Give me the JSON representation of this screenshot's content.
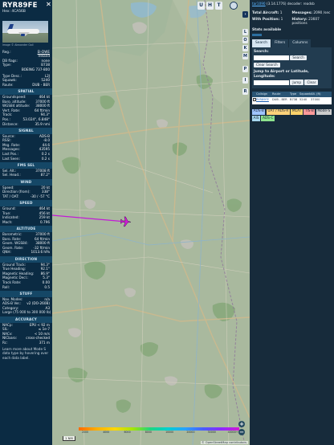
{
  "aircraft": {
    "callsign": "RYR89FE",
    "hex_line": "Hex: 4CA56B",
    "photo_credit": "Image © Alexander Gall",
    "reg_label": "Reg.:",
    "reg_value": "EI-DWE",
    "country": "Ireland",
    "db_flags_label": "DB flags:",
    "db_flags_value": "none",
    "type_label": "Type:",
    "type_value": "B738",
    "type_name": "BOEING 737-800",
    "type_desc_label": "Type Desc.:",
    "type_desc_value": "L2J",
    "squawk_label": "Squawk:",
    "squawk_value": "5240",
    "route_label": "Route:",
    "route_value": "DUB - BER"
  },
  "sections": {
    "spatial": "SPATIAL",
    "signal": "SIGNAL",
    "fms_sel": "FMS SEL",
    "wind": "WIND",
    "speed": "SPEED",
    "altitude": "ALTITUDE",
    "direction": "DIRECTION",
    "stuff": "STUFF",
    "accuracy": "ACCURACY"
  },
  "spatial": [
    {
      "k": "Groundspeed:",
      "v": "464 kt"
    },
    {
      "k": "Baro. altitude:",
      "v": "37000 ft"
    },
    {
      "k": "WGS84 altitude:",
      "v": "38000 ft"
    },
    {
      "k": "Vert. Rate:",
      "v": "64 ft/min"
    },
    {
      "k": "Track:",
      "v": "94.3°"
    },
    {
      "k": "Pos.:",
      "v": "53.024°, 6.848°"
    },
    {
      "k": "Distance:",
      "v": "35.9 nmi"
    }
  ],
  "signal": [
    {
      "k": "Source:",
      "v": "ADS-B"
    },
    {
      "k": "RSSI:",
      "v": "-8.0"
    },
    {
      "k": "Msg. Rate:",
      "v": "44.6"
    },
    {
      "k": "Messages:",
      "v": "43595"
    },
    {
      "k": "Last Pos.:",
      "v": "0.2 s"
    },
    {
      "k": "Last Seen:",
      "v": "0.2 s"
    }
  ],
  "fms": [
    {
      "k": "Sel. Alt.:",
      "v": "37008 ft"
    },
    {
      "k": "Sel. Head.:",
      "v": "87.2°"
    }
  ],
  "wind": [
    {
      "k": "Speed:",
      "v": "20 kt"
    },
    {
      "k": "Direction (from):",
      "v": "338°"
    },
    {
      "k": "TAT / OAT:",
      "v": "-30 / -57 °C"
    }
  ],
  "speed": [
    {
      "k": "Ground:",
      "v": "464 kt"
    },
    {
      "k": "True:",
      "v": "456 kt"
    },
    {
      "k": "Indicated:",
      "v": "259 kt"
    },
    {
      "k": "Mach:",
      "v": "0.796"
    }
  ],
  "altitude": [
    {
      "k": "Barometric:",
      "v": "37000 ft"
    },
    {
      "k": "Baro. Rate:",
      "v": "64 ft/min"
    },
    {
      "k": "Geom. WGS84:",
      "v": "38000 ft"
    },
    {
      "k": "Geom. Rate:",
      "v": "-32 ft/min"
    },
    {
      "k": "QNH:",
      "v": "1013.6 hPa"
    }
  ],
  "direction": [
    {
      "k": "Ground Track:",
      "v": "94.3°"
    },
    {
      "k": "True Heading:",
      "v": "92.1°"
    },
    {
      "k": "Magnetic Heading:",
      "v": "86.9°"
    },
    {
      "k": "Magnetic Decl.:",
      "v": "5.3°"
    },
    {
      "k": "Track Rate:",
      "v": "0.00"
    },
    {
      "k": "Roll:",
      "v": "0.5"
    }
  ],
  "stuff": [
    {
      "k": "Nav. Modes:",
      "v": "n/a"
    },
    {
      "k": "ADS-B Ver.:",
      "v": "v2 (DO-260B)"
    },
    {
      "k": "Category:",
      "v": "A3"
    }
  ],
  "stuff_note": "Large (75 000 to 300 000 lb)",
  "accuracy": [
    {
      "k": "NACp:",
      "v": "EPU < 92 m"
    },
    {
      "k": "SIL:",
      "v": "≤ 1e-7"
    },
    {
      "k": "NACv:",
      "v": "< 10 m/s"
    },
    {
      "k": "NICbaro:",
      "v": "cross-checked"
    },
    {
      "k": "Rc:",
      "v": "371 m"
    }
  ],
  "learn_more": "Learn more about Mode S data type by hovering over each data label.",
  "map": {
    "top_buttons": [
      "U",
      "H",
      "T"
    ],
    "side_buttons": [
      "L",
      "O",
      "K",
      "M",
      "P",
      "I",
      "R"
    ],
    "zoom_in": "+",
    "zoom_out": "−",
    "scale": "1 NM",
    "legend_ticks": [
      "2000",
      "4000",
      "6000",
      "8000",
      "10000",
      "20000",
      "30000",
      "40000+"
    ],
    "attribution": "© OpenStreetMap contributors.",
    "colors": {
      "track": "#c21bd6",
      "map_bg": "#a9b99e"
    }
  },
  "sidebar": {
    "link": "tar1090",
    "version_text": "(3.14.1776) decoder: readsb",
    "total_label": "Total Aircraft:",
    "total_value": "1",
    "messages_label": "Messages:",
    "messages_value": "2090 /sec",
    "withpos_label": "With Position:",
    "withpos_value": "1",
    "history_label": "History:",
    "history_value": "23607 positions",
    "stats_label": "Stats available",
    "tabs": [
      "Search",
      "Filters",
      "Columns"
    ],
    "search_label": "Search:",
    "search_button": "Search",
    "clear_search": "Clear Search",
    "jump_label": "Jump to Airport or Latitude, Longitude:",
    "jump_button": "Jump",
    "clear_button": "Clear",
    "columns": [
      "Callsign",
      "Route",
      "Type",
      "Squawk",
      "Alt. (ft)"
    ],
    "row": {
      "callsign": "RYR89FE",
      "route": "DUB - BER",
      "type": "B738",
      "squawk": "5240",
      "alt": "37000"
    },
    "chips": [
      {
        "label": "ADS-B",
        "color": "#9fc4ff"
      },
      {
        "label": "UAT / ADS-R",
        "color": "#ffd27a"
      },
      {
        "label": "MLAT",
        "color": "#ffd36b"
      },
      {
        "label": "TIS-B",
        "color": "#ff9a9a"
      },
      {
        "label": "Mode-S",
        "color": "#cccccc"
      },
      {
        "label": "AIS",
        "color": "#a8d8f0"
      },
      {
        "label": "ADS-C",
        "color": "#8ee48e"
      }
    ]
  }
}
